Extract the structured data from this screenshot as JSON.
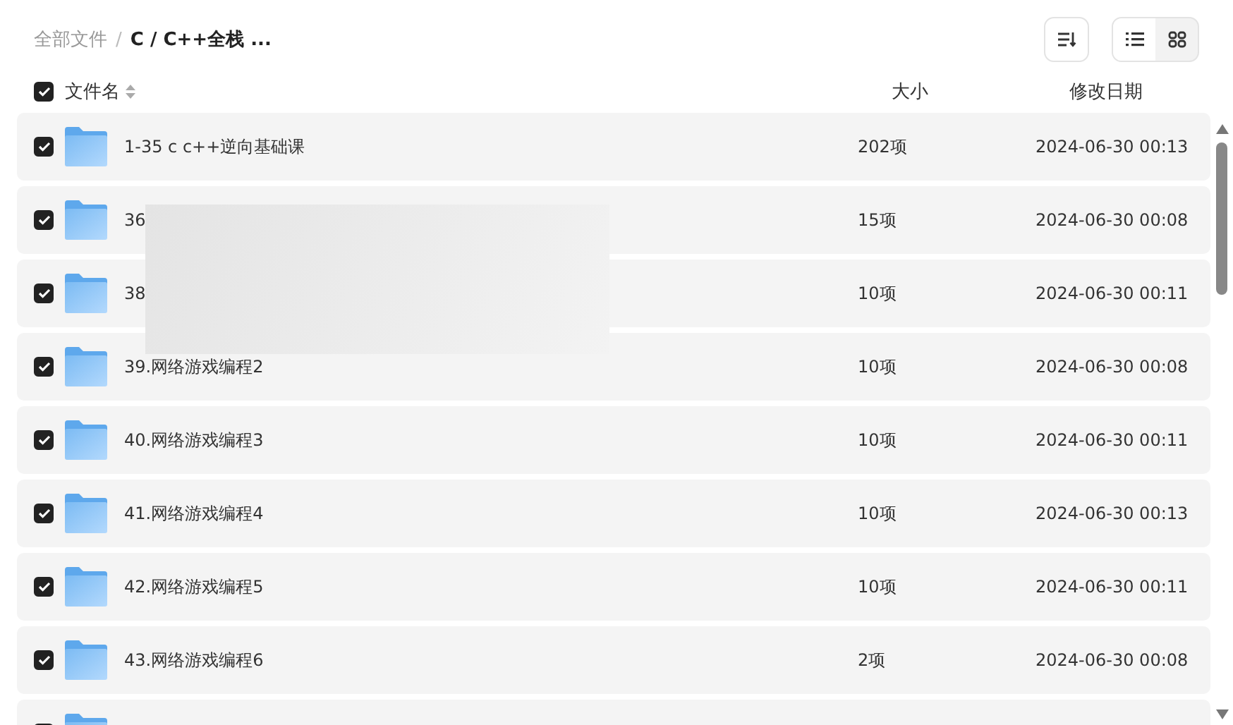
{
  "breadcrumb": {
    "root": "全部文件",
    "separator": "/",
    "current": "C / C++全栈 ..."
  },
  "view_modes": [
    {
      "kind": "list",
      "selected": true
    },
    {
      "kind": "grid",
      "selected": false
    }
  ],
  "columns": {
    "select_all_checked": true,
    "name": "文件名",
    "size": "大小",
    "date": "修改日期"
  },
  "rows": [
    {
      "checked": true,
      "name": "1-35 c c++逆向基础课",
      "size": "202项",
      "date": "2024-06-30 00:13"
    },
    {
      "checked": true,
      "name": "36",
      "size": "15项",
      "date": "2024-06-30 00:08"
    },
    {
      "checked": true,
      "name": "38",
      "size": "10项",
      "date": "2024-06-30 00:11"
    },
    {
      "checked": true,
      "name": "39.网络游戏编程2",
      "size": "10项",
      "date": "2024-06-30 00:08"
    },
    {
      "checked": true,
      "name": "40.网络游戏编程3",
      "size": "10项",
      "date": "2024-06-30 00:11"
    },
    {
      "checked": true,
      "name": "41.网络游戏编程4",
      "size": "10项",
      "date": "2024-06-30 00:13"
    },
    {
      "checked": true,
      "name": "42.网络游戏编程5",
      "size": "10项",
      "date": "2024-06-30 00:11"
    },
    {
      "checked": true,
      "name": "43.网络游戏编程6",
      "size": "2项",
      "date": "2024-06-30 00:08"
    },
    {
      "checked": true
    }
  ]
}
